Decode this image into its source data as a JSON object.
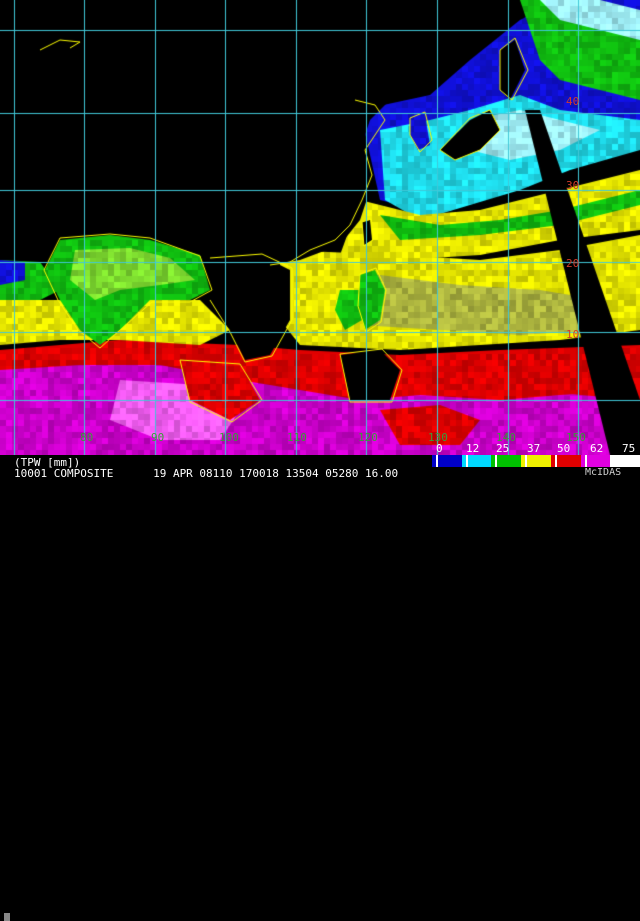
{
  "product": {
    "field_label": "(TPW [mm])",
    "info_line": "10001 COMPOSITE      19 APR 08110 170018 13504 05280 16.00",
    "software": "McIDAS"
  },
  "grid": {
    "longitude_labels": [
      "80",
      "90",
      "100",
      "110",
      "120",
      "130",
      "140",
      "150"
    ],
    "latitude_labels": [
      "40",
      "30",
      "20",
      "10"
    ]
  },
  "legend": {
    "units": "mm",
    "tick_labels": [
      "0",
      "12",
      "25",
      "37",
      "50",
      "62",
      "75"
    ],
    "colors": [
      "#0000c8",
      "#00d8ff",
      "#00c000",
      "#f0f000",
      "#e00000",
      "#e000e0",
      "#ffffff"
    ]
  },
  "palette": {
    "background": "#000000",
    "coastline": "#ffff00",
    "grid_lines": "#40c8d8",
    "swath_gap": "#000000"
  }
}
